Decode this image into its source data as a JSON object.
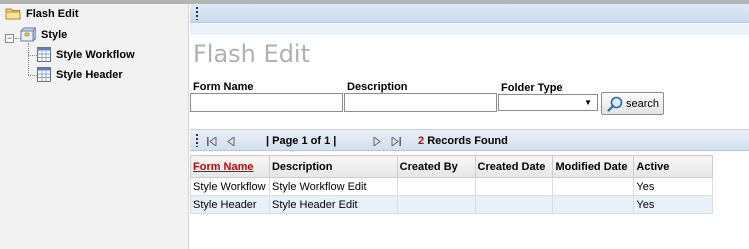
{
  "tree": {
    "root": {
      "label": "Flash Edit",
      "icon": "folder-icon"
    },
    "child": {
      "label": "Style",
      "icon": "package-icon",
      "expander": "−"
    },
    "leaves": [
      {
        "label": "Style Workflow",
        "icon": "grid-doc-icon"
      },
      {
        "label": "Style Header",
        "icon": "grid-doc-icon"
      }
    ]
  },
  "main": {
    "title": "Flash Edit",
    "filters": {
      "form_name_label": "Form Name",
      "form_name_value": "",
      "description_label": "Description",
      "description_value": "",
      "folder_type_label": "Folder Type",
      "folder_type_value": "",
      "search_label": "search"
    },
    "pager": {
      "page_text": "| Page 1 of 1 |",
      "records_count": "2",
      "records_text": "Records Found"
    },
    "grid": {
      "columns": [
        "Form Name",
        "Description",
        "Created By",
        "Created Date",
        "Modified Date",
        "Active"
      ],
      "rows": [
        [
          "Style Workflow",
          "Style Workflow Edit",
          "",
          "",
          "",
          "Yes"
        ],
        [
          "Style Header",
          "Style Header Edit",
          "",
          "",
          "",
          "Yes"
        ]
      ]
    }
  },
  "colors": {
    "sort_header": "#cc0000",
    "record_count": "#cc0000",
    "row_alt": "#e7f1fa",
    "title": "#b0b0b0"
  }
}
